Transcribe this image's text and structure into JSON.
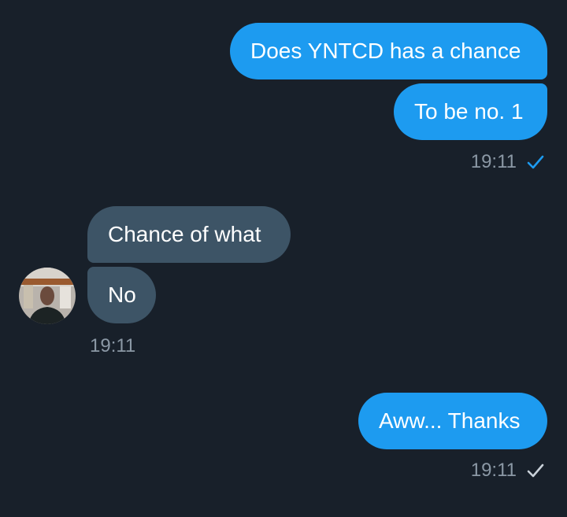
{
  "conversation": {
    "messages": [
      {
        "text": "Does YNTCD has a chance"
      },
      {
        "text": "To be no. 1"
      },
      {
        "text": "Chance of what"
      },
      {
        "text": "No"
      },
      {
        "text": "Aww... Thanks"
      }
    ],
    "timestamps": [
      "19:11",
      "19:11",
      "19:11"
    ],
    "read_status": [
      "read",
      "sent"
    ]
  },
  "icons": {
    "read": "check-icon",
    "sent": "check-icon",
    "avatar": "user-avatar"
  },
  "colors": {
    "background": "#18202a",
    "outgoing_bubble": "#1d9bf0",
    "incoming_bubble": "#3d5466",
    "timestamp": "#8b98a5",
    "read_check": "#1d9bf0",
    "sent_check": "#c9d1d9"
  }
}
